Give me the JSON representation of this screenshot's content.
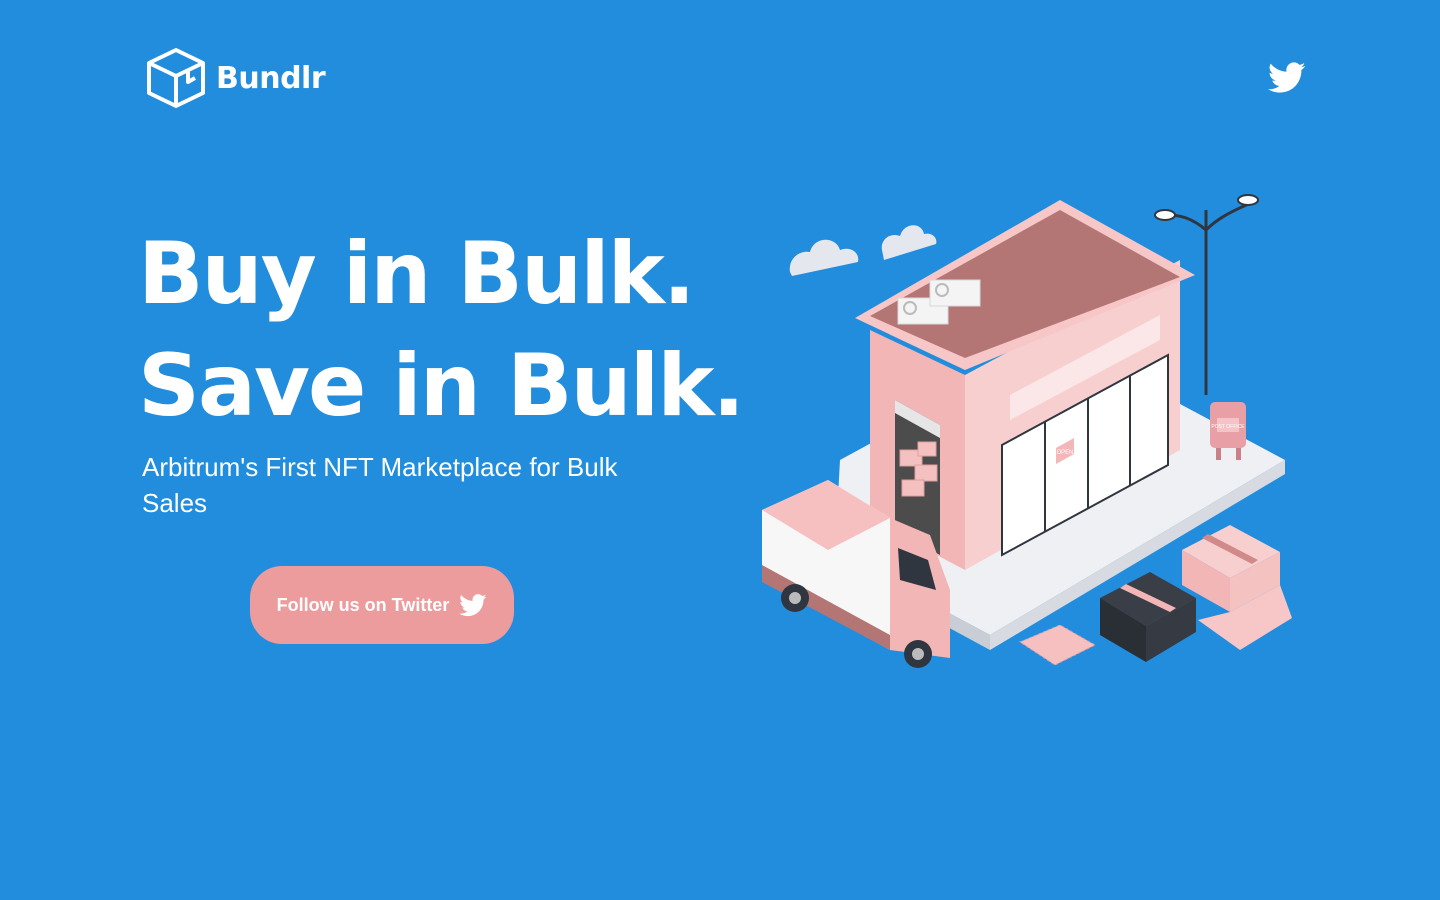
{
  "brand": {
    "name": "Bundlr",
    "logo_icon": "box-icon"
  },
  "nav": {
    "twitter_icon": "twitter-icon"
  },
  "hero": {
    "headline_line1": "Buy in Bulk.",
    "headline_line2": "Save in Bulk.",
    "subtitle": "Arbitrum's First NFT Marketplace for Bulk Sales",
    "cta_label": "Follow us on Twitter",
    "cta_icon": "twitter-icon"
  },
  "illustration": {
    "name": "storefront-delivery-illustration",
    "store_sign": "OPEN",
    "mailbox_label": "POST OFFICE"
  },
  "colors": {
    "background": "#218ddc",
    "accent_pink": "#ec9c9c",
    "text": "#ffffff"
  }
}
